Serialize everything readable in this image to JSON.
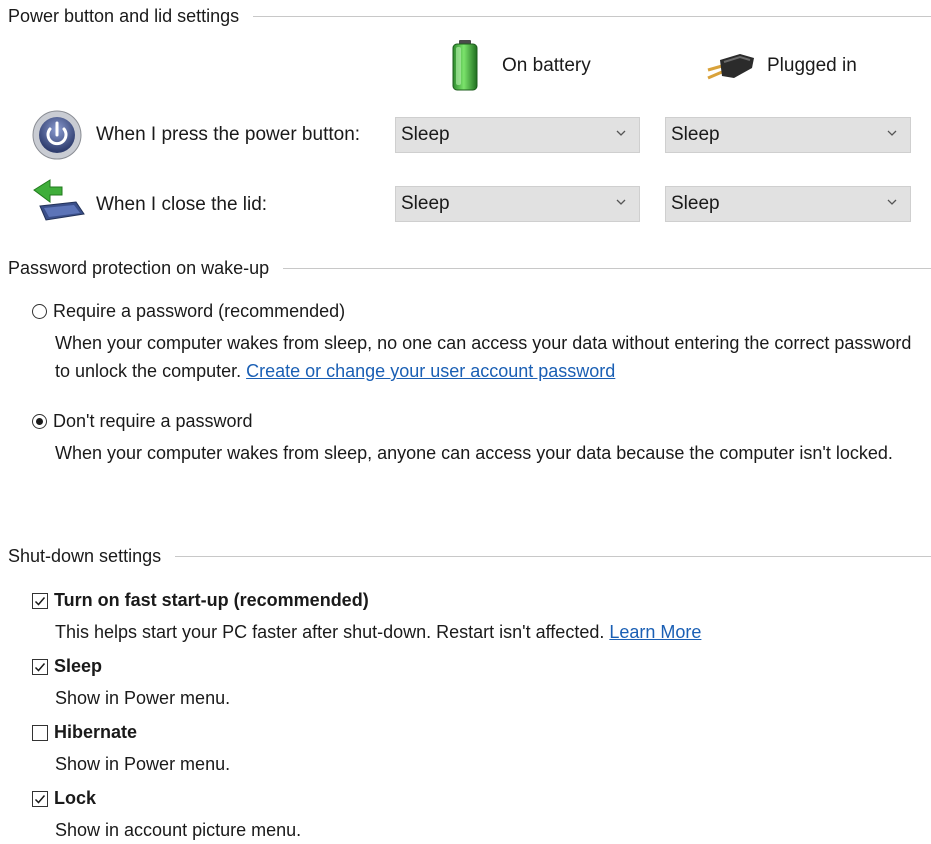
{
  "power_section": {
    "title": "Power button and lid settings",
    "columns": {
      "battery": {
        "label": "On battery",
        "icon": "battery-icon"
      },
      "plugged": {
        "label": "Plugged in",
        "icon": "plug-icon"
      }
    },
    "rows": [
      {
        "label": "When I press the power button:",
        "icon": "power-button-icon",
        "battery_value": "Sleep",
        "plugged_value": "Sleep"
      },
      {
        "label": "When I close the lid:",
        "icon": "laptop-lid-icon",
        "battery_value": "Sleep",
        "plugged_value": "Sleep"
      }
    ]
  },
  "password_section": {
    "title": "Password protection on wake-up",
    "require": {
      "label": "Require a password (recommended)",
      "checked": false,
      "description_text": "When your computer wakes from sleep, no one can access your data without entering the correct password to unlock the computer. ",
      "link_text": "Create or change your user account password"
    },
    "dont_require": {
      "label": "Don't require a password",
      "checked": true,
      "description_text": "When your computer wakes from sleep, anyone can access your data because the computer isn't locked."
    }
  },
  "shutdown_section": {
    "title": "Shut-down settings",
    "fast_startup": {
      "label": "Turn on fast start-up (recommended)",
      "checked": true,
      "description_text": "This helps start your PC faster after shut-down. Restart isn't affected. ",
      "link_text": "Learn More"
    },
    "sleep": {
      "label": "Sleep",
      "checked": true,
      "description_text": "Show in Power menu."
    },
    "hibernate": {
      "label": "Hibernate",
      "checked": false,
      "description_text": "Show in Power menu."
    },
    "lock": {
      "label": "Lock",
      "checked": true,
      "description_text": "Show in account picture menu."
    }
  },
  "colors": {
    "link": "#1a5fb4",
    "dropdown_bg": "#e1e1e1",
    "rule": "#c8c8c8"
  }
}
